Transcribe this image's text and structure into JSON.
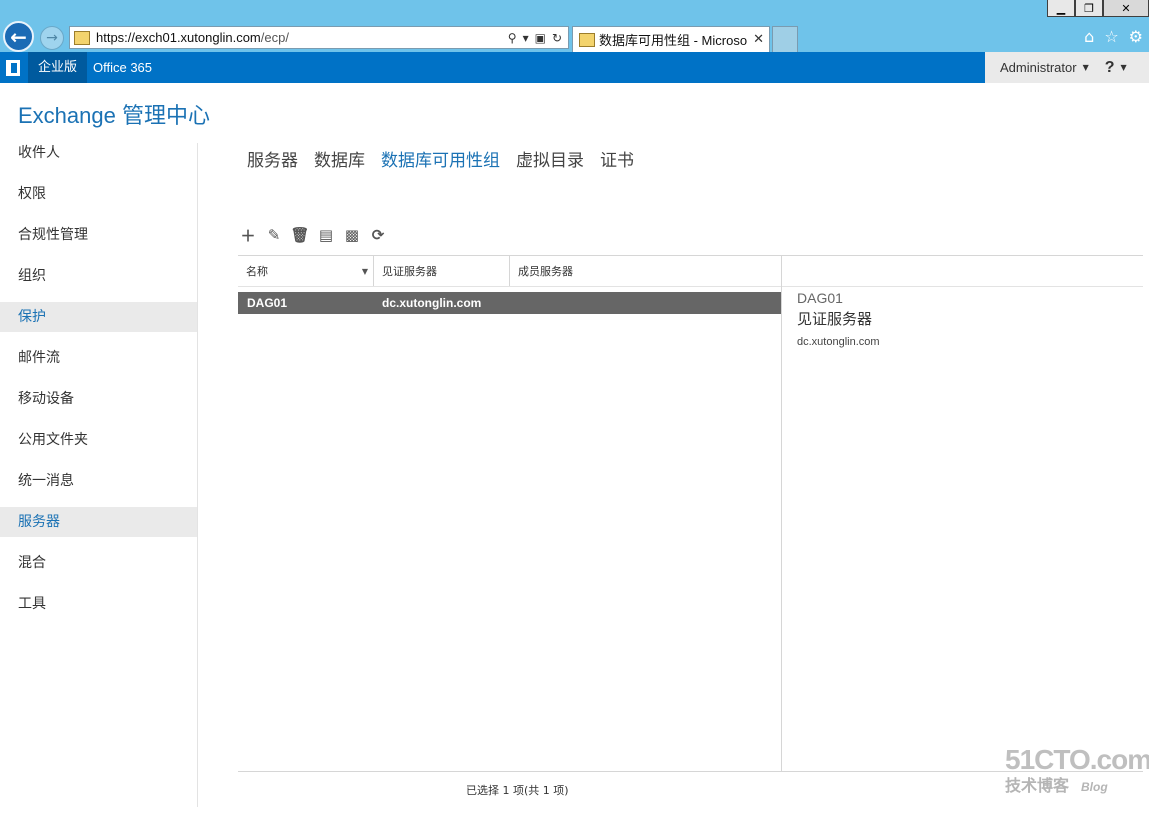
{
  "browser": {
    "url_host": "https://exch01.xutonglin.com",
    "url_path": "/ecp/",
    "tab_title": "数据库可用性组 - Microso...",
    "window_controls": [
      "minimize-icon",
      "restore-icon",
      "close-icon"
    ]
  },
  "suitebar": {
    "enterprise": "企业版",
    "office365": "Office 365",
    "user": "Administrator",
    "help": "?"
  },
  "app": {
    "title": "Exchange 管理中心"
  },
  "nav": {
    "items": [
      {
        "label": "收件人"
      },
      {
        "label": "权限"
      },
      {
        "label": "合规性管理"
      },
      {
        "label": "组织"
      },
      {
        "label": "保护"
      },
      {
        "label": "邮件流"
      },
      {
        "label": "移动设备"
      },
      {
        "label": "公用文件夹"
      },
      {
        "label": "统一消息"
      },
      {
        "label": "服务器"
      },
      {
        "label": "混合"
      },
      {
        "label": "工具"
      }
    ],
    "selected": "服务器"
  },
  "tabs": [
    {
      "label": "服务器"
    },
    {
      "label": "数据库"
    },
    {
      "label": "数据库可用性组"
    },
    {
      "label": "虚拟目录"
    },
    {
      "label": "证书"
    }
  ],
  "toolbar": [
    "add-icon",
    "edit-icon",
    "delete-icon",
    "add-server-icon",
    "network-settings-icon",
    "refresh-icon"
  ],
  "table": {
    "columns": [
      "名称",
      "见证服务器",
      "成员服务器"
    ],
    "rows": [
      {
        "name": "DAG01",
        "witness": "dc.xutonglin.com",
        "members": ""
      }
    ],
    "status": "已选择 1 项(共 1 项)"
  },
  "details": {
    "name": "DAG01",
    "heading": "见证服务器",
    "value": "dc.xutonglin.com"
  },
  "watermark": {
    "site": "51CTO.com",
    "text": "技术博客",
    "blog": "Blog"
  },
  "colors": {
    "suitebar": "#0072c6",
    "accent": "#1b72b4",
    "selected_row": "#666666",
    "chrome": "#6fc3ea"
  }
}
